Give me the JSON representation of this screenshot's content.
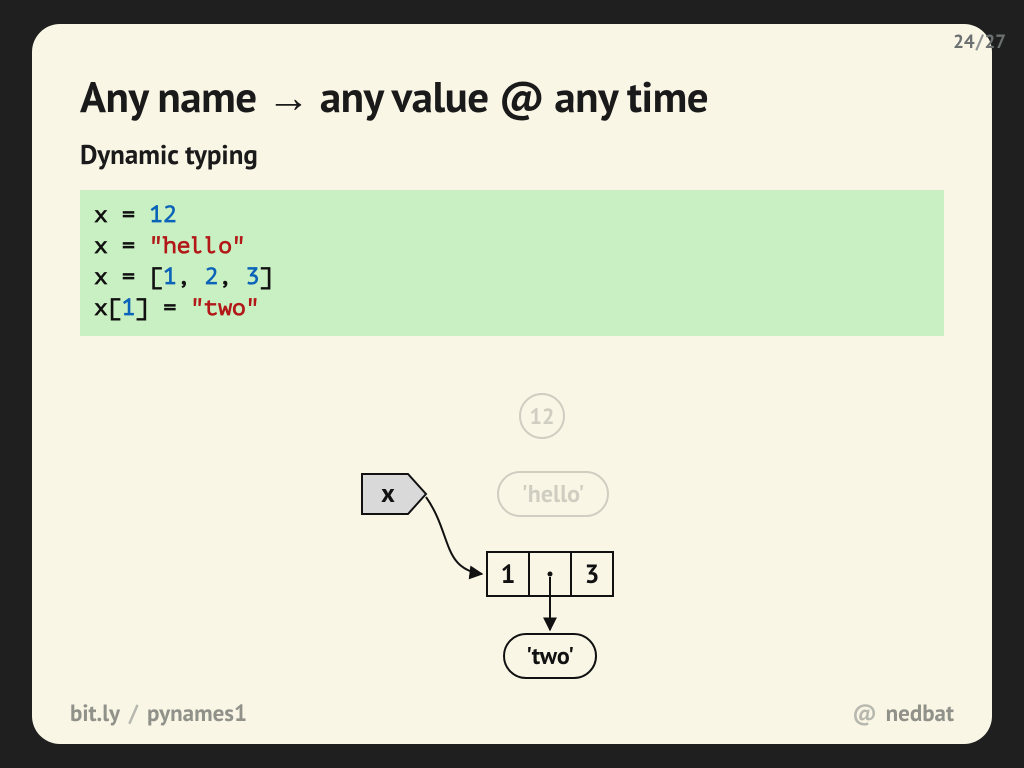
{
  "page": {
    "current": "24",
    "total": "27"
  },
  "title": "Any name → any value @ any time",
  "subtitle": "Dynamic typing",
  "code": {
    "l1a": "x = ",
    "l1b": "12",
    "l2a": "x = ",
    "l2b": "\"hello\"",
    "l3a": "x = [",
    "l3b": "1",
    "l3c": ", ",
    "l3d": "2",
    "l3e": ", ",
    "l3f": "3",
    "l3g": "]",
    "l4a": "x[",
    "l4b": "1",
    "l4c": "] = ",
    "l4d": "\"two\""
  },
  "diagram": {
    "name": "x",
    "old_int": "12",
    "old_str": "'hello'",
    "list": {
      "a": "1",
      "b": "",
      "c": "3"
    },
    "ref_str": "'two'"
  },
  "footer": {
    "link_host": "bit.ly",
    "link_path": "pynames1",
    "at": "@",
    "handle": "nedbat"
  }
}
